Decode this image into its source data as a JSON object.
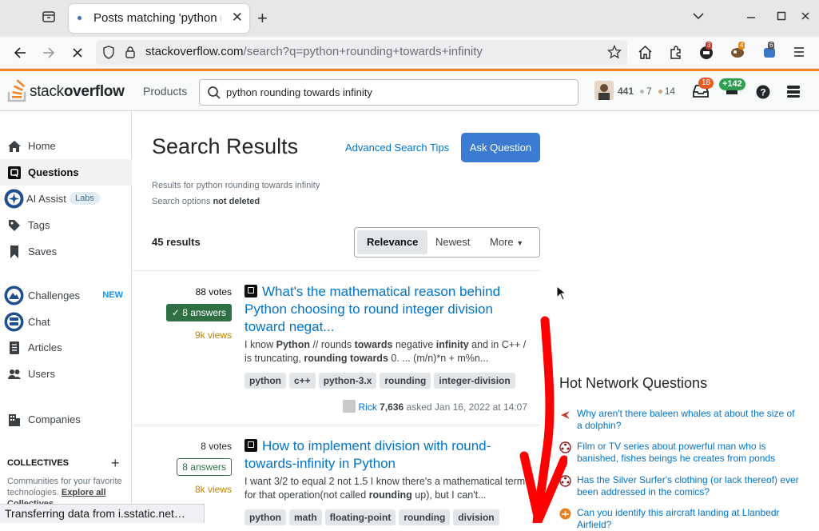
{
  "browser": {
    "tab_title": "Posts matching 'python rounding towards infinity'",
    "url_host": "stackoverflow.com",
    "url_rest": "/search?q=python+rounding+towards+infinity",
    "ext_badges": [
      "3",
      "4",
      "6"
    ]
  },
  "header": {
    "logo_light": "stack",
    "logo_bold": "overflow",
    "products": "Products",
    "search_value": "python rounding towards infinity",
    "reputation": "441",
    "silver": "7",
    "bronze": "14",
    "inbox_count": "18",
    "rep_change": "+142"
  },
  "sidebar": {
    "items": [
      {
        "label": "Home"
      },
      {
        "label": "Questions"
      },
      {
        "label": "AI Assist",
        "pill": "Labs"
      },
      {
        "label": "Tags"
      },
      {
        "label": "Saves"
      },
      {
        "label": "Challenges",
        "badge": "NEW"
      },
      {
        "label": "Chat"
      },
      {
        "label": "Articles"
      },
      {
        "label": "Users"
      },
      {
        "label": "Companies"
      }
    ],
    "collectives_title": "COLLECTIVES",
    "collectives_desc": "Communities for your favorite technologies.",
    "explore": "Explore all",
    "collectives_cut": "Collectives"
  },
  "main": {
    "title": "Search Results",
    "adv_tips": "Advanced Search Tips",
    "ask": "Ask Question",
    "results_for": "Results for python rounding towards infinity",
    "search_options_label": "Search options",
    "search_options_value": "not deleted",
    "count": "45 results",
    "sort": [
      "Relevance",
      "Newest",
      "More"
    ]
  },
  "questions": [
    {
      "votes": "88 votes",
      "answers": "8 answers",
      "views": "9k views",
      "title": "What's the mathematical reason behind Python choosing to round integer division toward negat...",
      "tags": [
        "python",
        "c++",
        "python-3.x",
        "rounding",
        "integer-division"
      ],
      "user": "Rick",
      "user_rep": "7,636",
      "asked": "asked Jan 16, 2022 at 14:07"
    },
    {
      "votes": "8 votes",
      "answers": "8 answers",
      "views": "8k views",
      "title": "How to implement division with round-towards-infinity in Python",
      "tags": [
        "python",
        "math",
        "floating-point",
        "rounding",
        "division"
      ]
    }
  ],
  "hot_network": {
    "title": "Hot Network Questions",
    "items": [
      "Why aren't there baleen whales at about the size of a dolphin?",
      "Film or TV series about powerful man who is banished, fishes beings he creates from ponds",
      "Has the Silver Surfer's clothing (or lack thereof) ever been addressed in the comics?",
      "Can you identify this aircraft landing at Llanbedr Airfield?"
    ]
  },
  "status_text": "Transferring data from i.sstatic.net…",
  "colors": {
    "accent": "#f48225",
    "link": "#0074cc",
    "primary_button": "#3b7bd4",
    "accepted": "#2f6f44",
    "annotation": "#ff0000"
  }
}
